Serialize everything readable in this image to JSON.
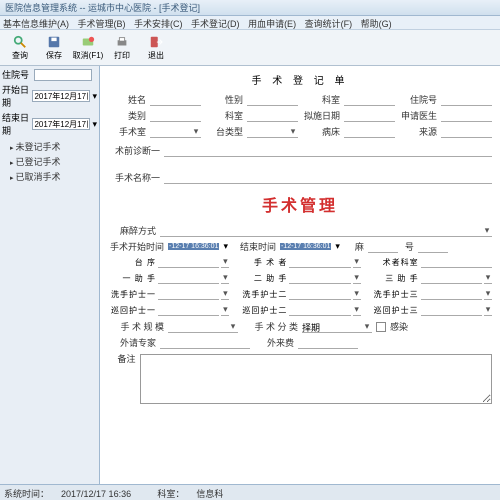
{
  "title": "医院信息管理系统 -- 运城市中心医院 - [手术登记]",
  "menu": [
    "基本信息维护(A)",
    "手术管理(B)",
    "手术安排(C)",
    "手术登记(D)",
    "用血申请(E)",
    "查询统计(F)",
    "帮助(G)"
  ],
  "toolbar": [
    {
      "name": "查询",
      "icon": "search"
    },
    {
      "name": "保存",
      "icon": "save"
    },
    {
      "name": "取消(F1)",
      "icon": "cancel"
    },
    {
      "name": "打印",
      "icon": "print"
    },
    {
      "name": "退出",
      "icon": "exit"
    }
  ],
  "left": {
    "id_label": "住院号",
    "start_label": "开始日期",
    "end_label": "结束日期",
    "start_date": "2017年12月17日",
    "end_date": "2017年12月17日",
    "tree": [
      "未登记手术",
      "已登记手术",
      "已取消手术"
    ]
  },
  "form": {
    "title": "手 术 登 记 单",
    "row1": {
      "name": "姓名",
      "sex": "性别",
      "dept": "科室",
      "inpat": "住院号"
    },
    "row2": {
      "kind": "类别",
      "chuang": "科室",
      "date": "拟施日期",
      "doctor": "申请医生"
    },
    "row3": {
      "room": "手术室",
      "type": "台类型",
      "ward": "病床",
      "src": "来源"
    },
    "preop": "术前诊断一",
    "opname": "手术名称一",
    "red": "手术管理",
    "anes_label": "麻醉方式",
    "start_label": "手术开始时间",
    "start_val": "-12-17 16:36:01",
    "end_label": "结束时间",
    "end_val": "-12-17 16:36:01",
    "bed": "麻",
    "num": "号",
    "grid": {
      "r1": [
        "台   序",
        "手 术 者",
        "术者科室"
      ],
      "r2": [
        "一 助 手",
        "二 助 手",
        "三 助 手"
      ],
      "r3": [
        "洗手护士一",
        "洗手护士二",
        "洗手护士三"
      ],
      "r4": [
        "巡回护士一",
        "巡回护士二",
        "巡回护士三"
      ]
    },
    "scale": "手 术 规 模",
    "class": "手 术 分 类",
    "class_val": "择期",
    "infect": "感染",
    "expert": "外请专家",
    "extfee": "外来费",
    "notes": "备注"
  },
  "status": {
    "time_label": "系统时间：",
    "time": "2017/12/17 16:36",
    "dept_label": "科室：",
    "dept": "信息科"
  }
}
